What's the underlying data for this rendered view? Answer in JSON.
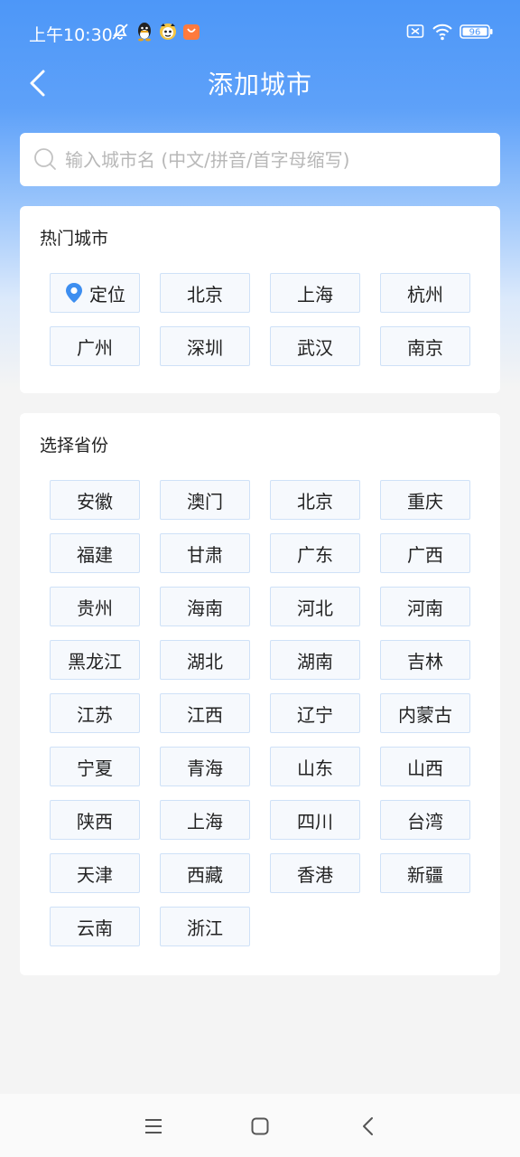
{
  "status_bar": {
    "time": "上午10:30",
    "battery": "96",
    "icons": [
      "mute-bell-icon",
      "qq-icon",
      "app-mascot-icon",
      "shopping-bag-icon",
      "sim-off-icon",
      "wifi-icon",
      "battery-icon"
    ]
  },
  "header": {
    "title": "添加城市",
    "back_icon": "chevron-left-icon"
  },
  "search": {
    "placeholder": "输入城市名 (中文/拼音/首字母缩写)",
    "value": "",
    "icon": "search-icon"
  },
  "hot_cities": {
    "title": "热门城市",
    "items": [
      {
        "label": "定位",
        "icon": "location-pin-icon"
      },
      {
        "label": "北京"
      },
      {
        "label": "上海"
      },
      {
        "label": "杭州"
      },
      {
        "label": "广州"
      },
      {
        "label": "深圳"
      },
      {
        "label": "武汉"
      },
      {
        "label": "南京"
      }
    ]
  },
  "provinces": {
    "title": "选择省份",
    "items": [
      "安徽",
      "澳门",
      "北京",
      "重庆",
      "福建",
      "甘肃",
      "广东",
      "广西",
      "贵州",
      "海南",
      "河北",
      "河南",
      "黑龙江",
      "湖北",
      "湖南",
      "吉林",
      "江苏",
      "江西",
      "辽宁",
      "内蒙古",
      "宁夏",
      "青海",
      "山东",
      "山西",
      "陕西",
      "上海",
      "四川",
      "台湾",
      "天津",
      "西藏",
      "香港",
      "新疆",
      "云南",
      "浙江"
    ]
  },
  "colors": {
    "header_blue": "#4d97f8",
    "location_pin": "#3d8ef0",
    "button_border": "#cfe1f7"
  },
  "bottom_nav": {
    "icons": [
      "menu-icon",
      "home-square-icon",
      "back-triangle-icon"
    ]
  }
}
